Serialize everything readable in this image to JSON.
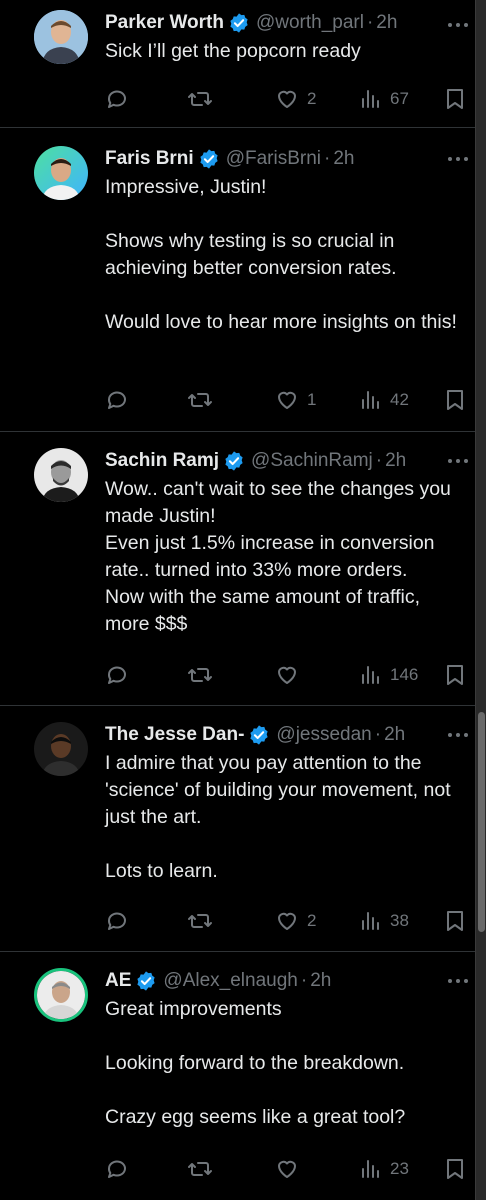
{
  "tweets": [
    {
      "name": "Parker Worth",
      "handle": "@worth_parl",
      "time": "2h",
      "text": "Sick I’ll get the popcorn ready",
      "likes": "2",
      "views": "67"
    },
    {
      "name": "Faris Brni",
      "handle": "@FarisBrni",
      "time": "2h",
      "text": "Impressive, Justin!\n\nShows why testing is so crucial in achieving better conversion rates.\n\nWould love to hear more insights on this!",
      "likes": "1",
      "views": "42"
    },
    {
      "name": "Sachin Ramj",
      "handle": "@SachinRamj",
      "time": "2h",
      "text": "Wow.. can't wait to see the changes you made Justin!\nEven just 1.5% increase in conversion rate.. turned into 33% more orders.\nNow with the same amount of traffic, more $$$",
      "likes": "",
      "views": "146"
    },
    {
      "name": "The Jesse Dan-",
      "handle": "@jessedan",
      "time": "2h",
      "text": "I admire that you pay attention to the 'science' of building your movement, not just the art.\n\nLots to learn.",
      "likes": "2",
      "views": "38"
    },
    {
      "name": "AE",
      "handle": "@Alex_elnaugh",
      "time": "2h",
      "text": "Great improvements\n\nLooking forward to the breakdown.\n\nCrazy egg seems like a great tool?",
      "likes": "",
      "views": "23"
    }
  ],
  "separator": "·",
  "colors": {
    "background": "#000000",
    "text": "#e7e9ea",
    "muted": "#71767b",
    "verified": "#1d9bf0",
    "divider": "#2f3336"
  },
  "icons": {
    "reply": "reply-icon",
    "retweet": "retweet-icon",
    "like": "heart-icon",
    "views": "views-icon",
    "bookmark": "bookmark-icon",
    "more": "more-icon",
    "verified": "verified-badge-icon"
  }
}
